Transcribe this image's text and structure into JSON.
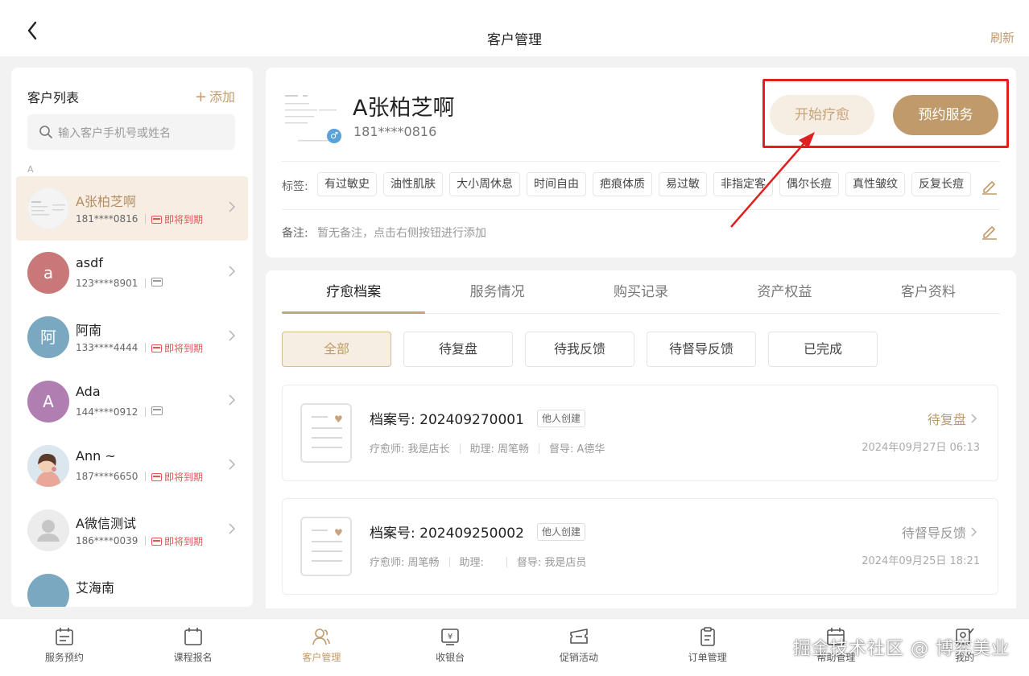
{
  "header": {
    "title": "客户管理",
    "refresh_label": "刷新"
  },
  "customer_list": {
    "title": "客户列表",
    "add_label": "添加",
    "search_placeholder": "输入客户手机号或姓名",
    "section_letter": "A",
    "items": [
      {
        "name": "A张柏芝啊",
        "phone": "181****0816",
        "badge": "即将到期",
        "active": true
      },
      {
        "name": "asdf",
        "phone": "123****8901",
        "badge": "",
        "avatar_letter": "a",
        "avatar_color": "#c87878"
      },
      {
        "name": "阿南",
        "phone": "133****4444",
        "badge": "即将到期",
        "avatar_letter": "阿",
        "avatar_color": "#7aa8c0"
      },
      {
        "name": "Ada",
        "phone": "144****0912",
        "badge": "",
        "avatar_letter": "A",
        "avatar_color": "#b07eb0"
      },
      {
        "name": "Ann ~",
        "phone": "187****6650",
        "badge": "即将到期"
      },
      {
        "name": "A微信测试",
        "phone": "186****0039",
        "badge": "即将到期"
      },
      {
        "name": "艾海南",
        "phone": "",
        "badge": ""
      }
    ]
  },
  "profile": {
    "name": "A张柏芝啊",
    "phone": "181****0816",
    "gender_symbol": "♂",
    "start_button": "开始疗愈",
    "book_button": "预约服务",
    "tags_label": "标签:",
    "tags": [
      "有过敏史",
      "油性肌肤",
      "大小周休息",
      "时间自由",
      "疤痕体质",
      "易过敏",
      "非指定客",
      "偶尔长痘",
      "真性皱纹",
      "反复长痘"
    ],
    "note_label": "备注:",
    "note_text": "暂无备注，点击右侧按钮进行添加"
  },
  "records": {
    "tabs": [
      "疗愈档案",
      "服务情况",
      "购买记录",
      "资产权益",
      "客户资料"
    ],
    "filters": [
      "全部",
      "待复盘",
      "待我反馈",
      "待督导反馈",
      "已完成"
    ],
    "items": [
      {
        "id_label": "档案号:",
        "id": "202409270001",
        "creator": "他人创建",
        "therapist": "疗愈师: 我是店长",
        "assistant": "助理: 周笔畅",
        "supervisor": "督导: A德华",
        "status": "待复盘",
        "status_color": "#c09a6b",
        "date": "2024年09月27日 06:13"
      },
      {
        "id_label": "档案号:",
        "id": "202409250002",
        "creator": "他人创建",
        "therapist": "疗愈师: 周笔畅",
        "assistant": "助理:",
        "supervisor": "督导: 我是店员",
        "status": "待督导反馈",
        "status_color": "#999999",
        "date": "2024年09月25日 18:21"
      }
    ]
  },
  "bottom_nav": [
    {
      "label": "服务预约",
      "icon": "calendar-icon"
    },
    {
      "label": "课程报名",
      "icon": "calendar-blank-icon"
    },
    {
      "label": "客户管理",
      "icon": "users-icon",
      "active": true
    },
    {
      "label": "收银台",
      "icon": "cashier-icon"
    },
    {
      "label": "促销活动",
      "icon": "ticket-icon"
    },
    {
      "label": "订单管理",
      "icon": "clipboard-icon"
    },
    {
      "label": "帮助管理",
      "icon": "calendar-icon"
    },
    {
      "label": "我的",
      "icon": "user-icon"
    }
  ],
  "watermark": "掘金技术社区 @ 博弈美业",
  "colors": {
    "accent": "#c09a6b",
    "accent_light": "#f6ede3",
    "expiry_red": "#e05656",
    "highlight_red": "#e02020"
  }
}
